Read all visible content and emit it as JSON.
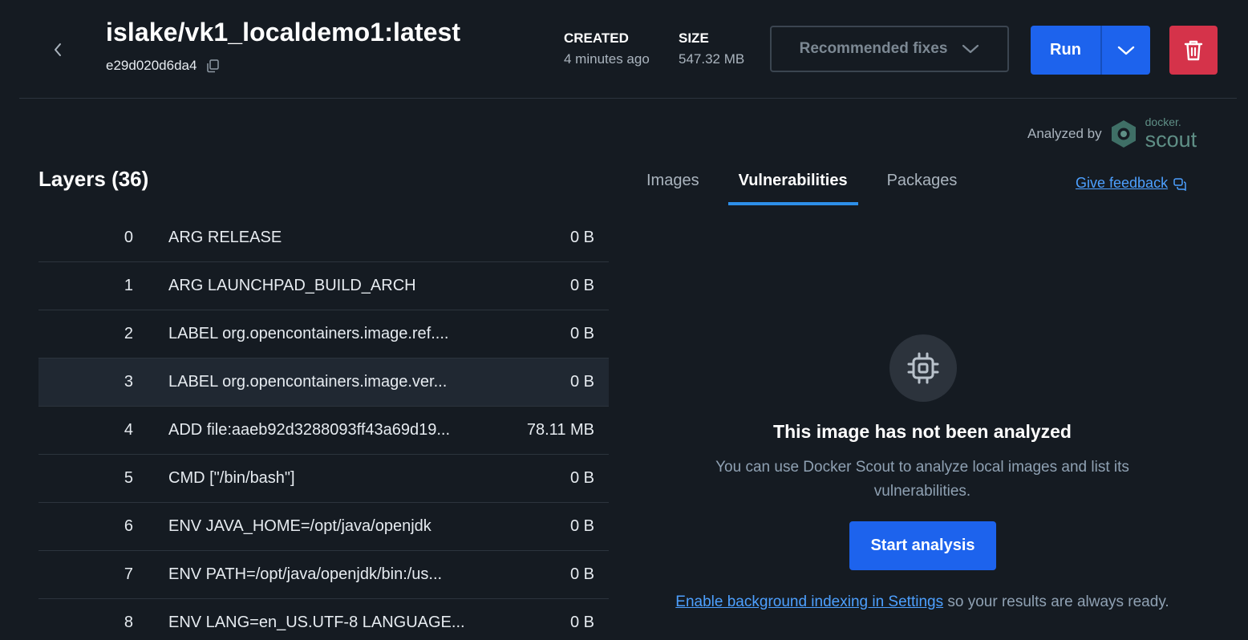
{
  "header": {
    "title": "islake/vk1_localdemo1:latest",
    "image_id": "e29d020d6da4",
    "created_label": "CREATED",
    "created_value": "4 minutes ago",
    "size_label": "SIZE",
    "size_value": "547.32 MB",
    "recommended_fixes": "Recommended fixes",
    "run_label": "Run"
  },
  "analyzed": {
    "label": "Analyzed by",
    "brand_small": "docker.",
    "brand_big": "scout"
  },
  "layers": {
    "title": "Layers (36)",
    "selected_index": 3,
    "rows": [
      {
        "index": "0",
        "command": "ARG RELEASE",
        "size": "0 B"
      },
      {
        "index": "1",
        "command": "ARG LAUNCHPAD_BUILD_ARCH",
        "size": "0 B"
      },
      {
        "index": "2",
        "command": "LABEL org.opencontainers.image.ref....",
        "size": "0 B"
      },
      {
        "index": "3",
        "command": "LABEL org.opencontainers.image.ver...",
        "size": "0 B"
      },
      {
        "index": "4",
        "command": "ADD file:aaeb92d3288093ff43a69d19...",
        "size": "78.11 MB"
      },
      {
        "index": "5",
        "command": "CMD [\"/bin/bash\"]",
        "size": "0 B"
      },
      {
        "index": "6",
        "command": "ENV JAVA_HOME=/opt/java/openjdk",
        "size": "0 B"
      },
      {
        "index": "7",
        "command": "ENV PATH=/opt/java/openjdk/bin:/us...",
        "size": "0 B"
      },
      {
        "index": "8",
        "command": "ENV LANG=en_US.UTF-8 LANGUAGE...",
        "size": "0 B"
      }
    ]
  },
  "tabs": {
    "items": [
      {
        "label": "Images",
        "active": false
      },
      {
        "label": "Vulnerabilities",
        "active": true
      },
      {
        "label": "Packages",
        "active": false
      }
    ],
    "feedback_label": "Give feedback"
  },
  "empty_state": {
    "icon": "chip-icon",
    "title": "This image has not been analyzed",
    "description": "You can use Docker Scout to analyze local images and list its vulnerabilities.",
    "button_label": "Start analysis",
    "settings_link": "Enable background indexing in Settings",
    "settings_suffix": " so your results are always ready."
  },
  "colors": {
    "background": "#151b22",
    "primary": "#1d63ed",
    "danger": "#d5334a",
    "link": "#4da0ff",
    "tab_indicator": "#2d8fe9"
  }
}
